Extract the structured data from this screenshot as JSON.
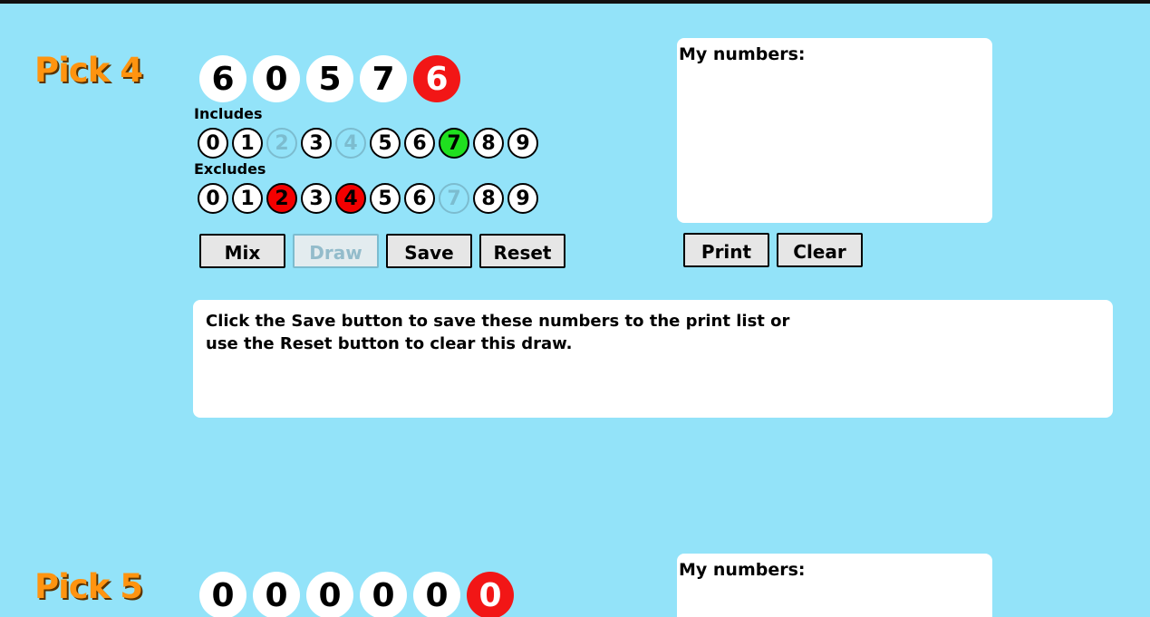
{
  "pick4": {
    "title": "Pick 4",
    "balls": [
      "6",
      "0",
      "5",
      "7"
    ],
    "bonus": "6",
    "includes_label": "Includes",
    "includes": [
      {
        "d": "0",
        "state": "normal"
      },
      {
        "d": "1",
        "state": "normal"
      },
      {
        "d": "2",
        "state": "disabled"
      },
      {
        "d": "3",
        "state": "normal"
      },
      {
        "d": "4",
        "state": "disabled"
      },
      {
        "d": "5",
        "state": "normal"
      },
      {
        "d": "6",
        "state": "normal"
      },
      {
        "d": "7",
        "state": "green"
      },
      {
        "d": "8",
        "state": "normal"
      },
      {
        "d": "9",
        "state": "normal"
      }
    ],
    "excludes_label": "Excludes",
    "excludes": [
      {
        "d": "0",
        "state": "normal"
      },
      {
        "d": "1",
        "state": "normal"
      },
      {
        "d": "2",
        "state": "red"
      },
      {
        "d": "3",
        "state": "normal"
      },
      {
        "d": "4",
        "state": "red"
      },
      {
        "d": "5",
        "state": "normal"
      },
      {
        "d": "6",
        "state": "normal"
      },
      {
        "d": "7",
        "state": "disabled"
      },
      {
        "d": "8",
        "state": "normal"
      },
      {
        "d": "9",
        "state": "normal"
      }
    ],
    "buttons": {
      "mix": "Mix",
      "draw": "Draw",
      "save": "Save",
      "reset": "Reset"
    },
    "my_numbers_label": "My numbers:",
    "print_label": "Print",
    "clear_label": "Clear",
    "message_line1": "Click the Save button to save these numbers to the print list or",
    "message_line2": "use the Reset button to clear this draw."
  },
  "pick5": {
    "title": "Pick 5",
    "balls": [
      "0",
      "0",
      "0",
      "0",
      "0"
    ],
    "bonus": "0",
    "my_numbers_label": "My numbers:"
  },
  "colors": {
    "background": "#93e3f9",
    "title": "#ff9410",
    "bonus_ball": "#f21616",
    "include_selected": "#1fe01f",
    "exclude_selected": "#f40000"
  }
}
